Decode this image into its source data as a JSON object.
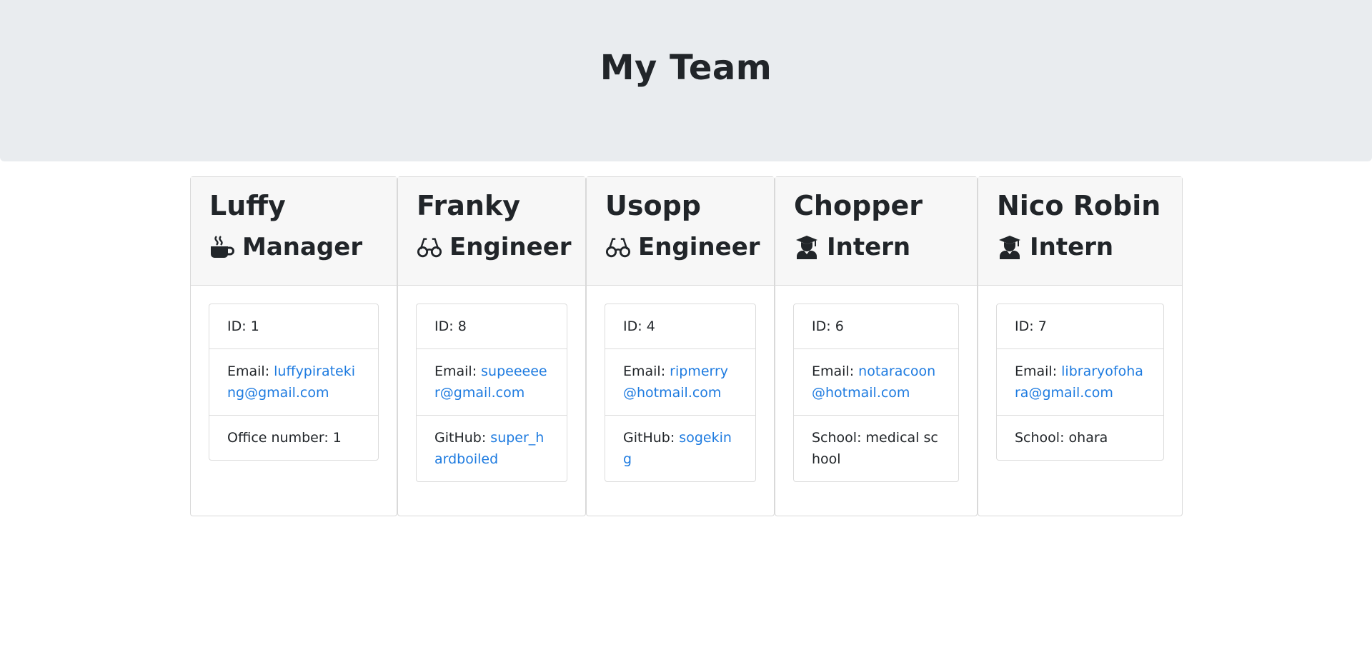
{
  "header": {
    "title": "My Team"
  },
  "labels": {
    "id": "ID: ",
    "email": "Email: ",
    "office": "Office number: ",
    "github": "GitHub: ",
    "school": "School: "
  },
  "members": [
    {
      "name": "Luffy",
      "role": "Manager",
      "icon": "coffee-icon",
      "id": "1",
      "email": "luffypirateking@gmail.com",
      "office": "1"
    },
    {
      "name": "Franky",
      "role": "Engineer",
      "icon": "glasses-icon",
      "id": "8",
      "email": "supeeeeer@gmail.com",
      "github": "super_hardboiled"
    },
    {
      "name": "Usopp",
      "role": "Engineer",
      "icon": "glasses-icon",
      "id": "4",
      "email": "ripmerry@hotmail.com",
      "github": "sogeking"
    },
    {
      "name": "Chopper",
      "role": "Intern",
      "icon": "graduate-icon",
      "id": "6",
      "email": "notaracoon@hotmail.com",
      "school": "medical school"
    },
    {
      "name": "Nico Robin",
      "role": "Intern",
      "icon": "graduate-icon",
      "id": "7",
      "email": "libraryofohara@gmail.com",
      "school": "ohara"
    }
  ],
  "colors": {
    "link": "#1e7be0",
    "header_bg": "#e9ecef",
    "card_header_bg": "#f7f7f7"
  }
}
